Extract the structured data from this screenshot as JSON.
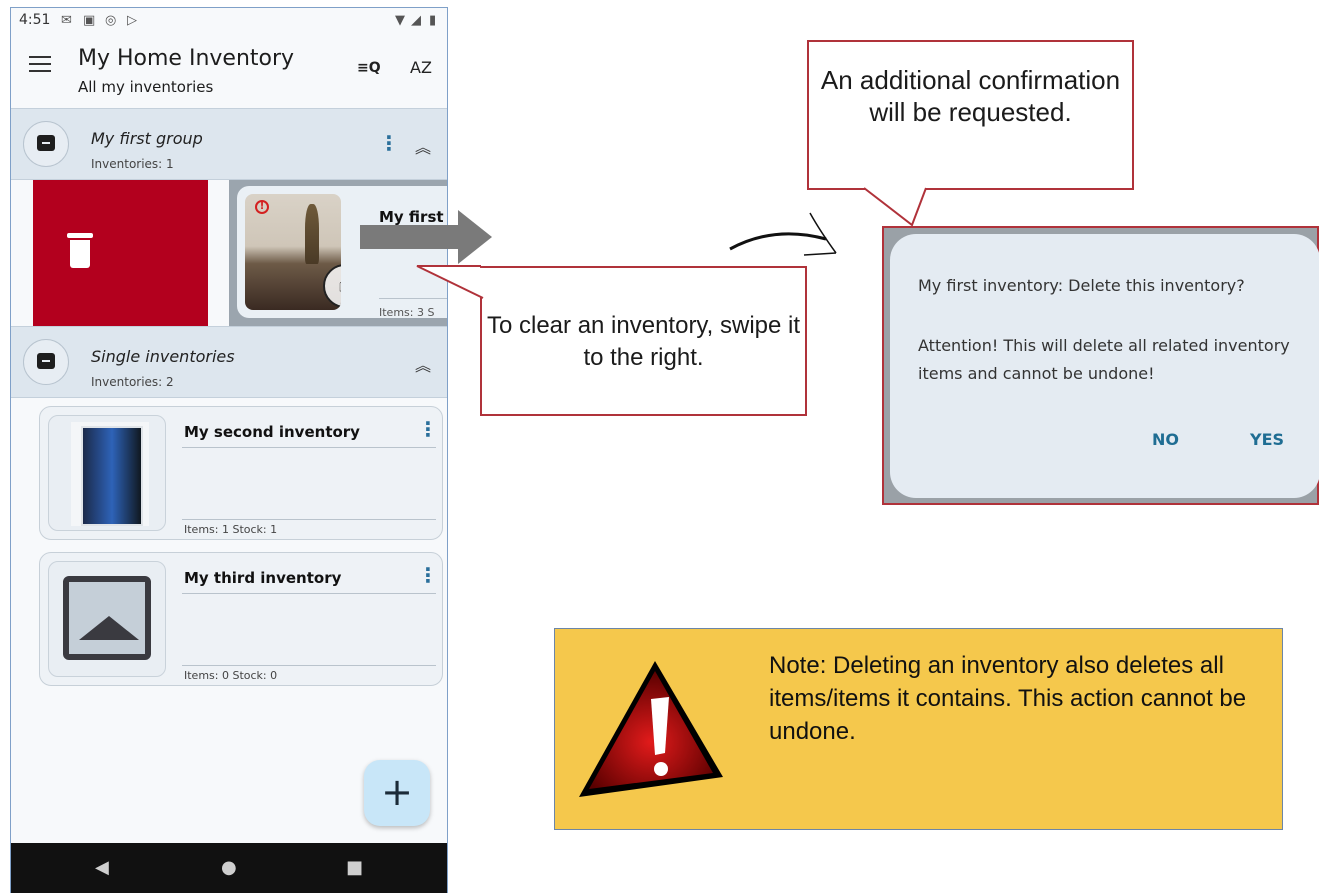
{
  "status_bar": {
    "time": "4:51"
  },
  "app": {
    "title": "My Home Inventory",
    "subtitle": "All my inventories",
    "sort_label": "AZ"
  },
  "groups": [
    {
      "name": "My first group",
      "count": "Inventories: 1"
    },
    {
      "name": "Single inventories",
      "count": "Inventories: 2"
    }
  ],
  "swiped_inventory": {
    "title": "My first i",
    "stats": "Items: 3   S"
  },
  "inventories": [
    {
      "title": "My second inventory",
      "stats": "Items: 1   Stock: 1"
    },
    {
      "title": "My third inventory",
      "stats": "Items: 0   Stock: 0"
    }
  ],
  "fab": {
    "label": "+"
  },
  "callouts": {
    "confirm": "An additional confirmation will be requested.",
    "swipe": "To clear an inventory, swipe it to the right."
  },
  "dialog": {
    "title": "My first inventory: Delete this inventory?",
    "message": "Attention! This will delete all related inventory items and cannot be undone!",
    "no": "NO",
    "yes": "YES"
  },
  "note": {
    "text": "Note: Deleting an inventory also deletes all items/items it contains. This action cannot be undone."
  },
  "colors": {
    "delete_red": "#b3001e",
    "callout_border": "#b0323a",
    "note_bg": "#f5c84c",
    "dialog_button": "#1f6d93"
  },
  "icons": [
    "menu-icon",
    "search-icon",
    "sort-icon",
    "kebab-icon",
    "collapse-icon",
    "trash-icon",
    "warning-icon",
    "hand-icon",
    "add-icon",
    "back-icon",
    "home-icon",
    "recents-icon"
  ]
}
